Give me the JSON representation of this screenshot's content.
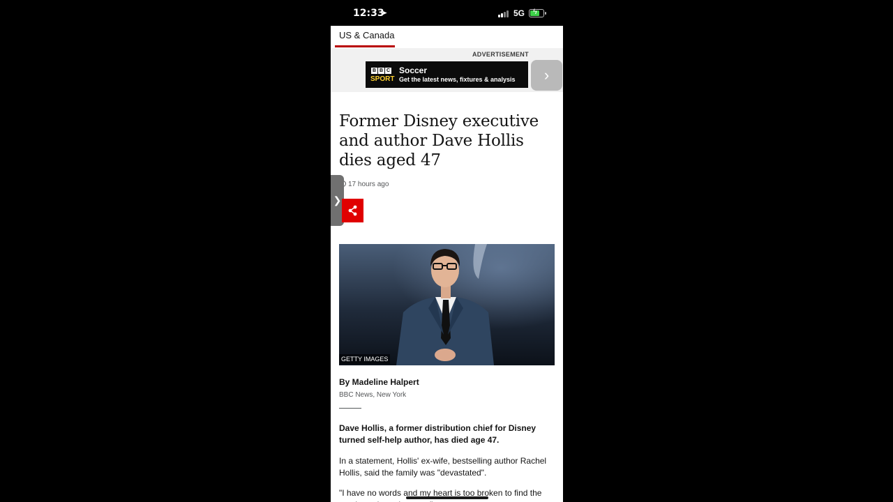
{
  "status_bar": {
    "time": "12:33",
    "network": "5G",
    "location_icon": "location-arrow-icon",
    "battery": "charging"
  },
  "nav": {
    "section_tab": "US & Canada"
  },
  "advertisement": {
    "label": "ADVERTISEMENT",
    "brand_letters": [
      "B",
      "B",
      "C"
    ],
    "brand_sport": "SPORT",
    "title": "Soccer",
    "subtitle": "Get the latest news, fixtures & analysis",
    "next_icon": "chevron-right-icon"
  },
  "article": {
    "headline": "Former Disney executive and author Dave Hollis dies aged 47",
    "timestamp": "17 hours ago",
    "share_icon": "share-icon",
    "image_credit": "GETTY IMAGES",
    "byline": "By Madeline Halpert",
    "byline_role": "BBC News, New York",
    "paragraphs": [
      "Dave Hollis, a former distribution chief for Disney turned self-help author, has died age 47.",
      "In a statement, Hollis' ex-wife, bestselling author Rachel Hollis, said the family was \"devastated\".",
      "\"I have no words and my heart is too broken to find the words to share the news\""
    ]
  },
  "colors": {
    "accent_red": "#b80000",
    "share_red": "#e00000",
    "ad_bg": "#0b0b0b",
    "sport_yellow": "#ffd230"
  }
}
